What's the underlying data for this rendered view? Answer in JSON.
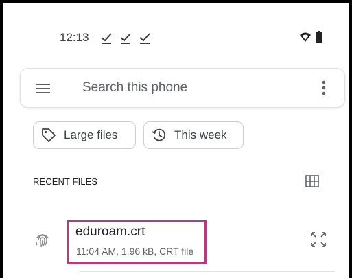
{
  "status_bar": {
    "time": "12:13",
    "icons": [
      "download-done-icon",
      "download-done-icon",
      "download-done-icon",
      "wifi-icon",
      "battery-icon"
    ]
  },
  "search": {
    "placeholder": "Search this phone",
    "menu_icon": "hamburger-menu-icon",
    "more_icon": "more-vert-icon"
  },
  "chips": [
    {
      "label": "Large files",
      "icon": "tag-icon"
    },
    {
      "label": "This week",
      "icon": "history-icon"
    }
  ],
  "recent_files": {
    "title": "RECENT FILES",
    "view_icon": "grid-view-icon",
    "items": [
      {
        "name": "eduroam.crt",
        "meta": "11:04 AM, 1.96 kB, CRT file",
        "icon": "fingerprint-icon",
        "action_icon": "expand-icon"
      }
    ]
  },
  "colors": {
    "highlight": "#c2357b",
    "text_primary": "#202124",
    "text_secondary": "#5f6368"
  }
}
